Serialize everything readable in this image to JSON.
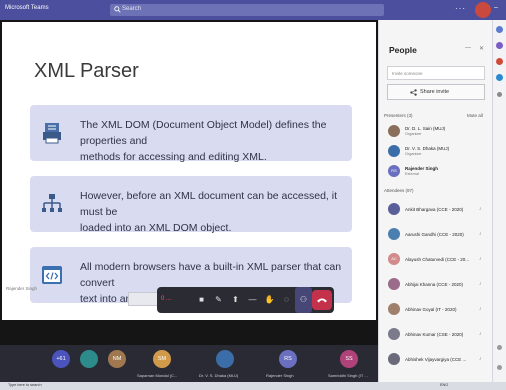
{
  "titlebar": {
    "app_title": "Microsoft Teams",
    "search_placeholder": "Search"
  },
  "slide": {
    "title": "XML Parser",
    "cards": [
      {
        "icon": "document-icon",
        "text_line1": "The XML DOM (Document Object Model) defines the properties and",
        "text_line2": "methods for accessing and editing XML."
      },
      {
        "icon": "hierarchy-icon",
        "text_line1": "However, before an XML document can be accessed, it must be",
        "text_line2": "loaded into an XML DOM object."
      },
      {
        "icon": "code-icon",
        "text_line1": "All modern browsers have a built-in XML parser that can convert",
        "text_line2": "text into an XML DOM object."
      }
    ],
    "presenter_label": "Rajender Singh"
  },
  "controls": {
    "timer": "0 ..."
  },
  "participants": [
    {
      "initials": "+61",
      "color": "#4b53bc",
      "name": ""
    },
    {
      "initials": "",
      "color": "#2e8b8b",
      "name": ""
    },
    {
      "initials": "NM",
      "color": "#a07850",
      "name": ""
    },
    {
      "initials": "SM",
      "color": "#d19a4a",
      "name": "Saparnan Mondal (C..."
    },
    {
      "initials": "",
      "color": "#3b6ea8",
      "name": "Dr. V. S. Dhaka (MUJ)"
    },
    {
      "initials": "RS",
      "color": "#6b6fbf",
      "name": "Rajender Singh"
    },
    {
      "initials": "SS",
      "color": "#b0427a",
      "name": "Samriddhi Singh (IT ..."
    }
  ],
  "people_panel": {
    "title": "People",
    "invite_placeholder": "Invite someone",
    "share_invite_label": "Share invite",
    "presenters_label": "Presenters (3)",
    "mute_all_label": "Mute all",
    "presenters": [
      {
        "initials": "",
        "color": "#8a6d5a",
        "name": "Dr. D. L. Sain (MUJ)",
        "role": "Organizer"
      },
      {
        "initials": "",
        "color": "#3b6ea8",
        "name": "Dr. V. S. Dhaka (MUJ)",
        "role": "Organizer"
      },
      {
        "initials": "RS",
        "color": "#6b6fbf",
        "name": "Rajender Singh",
        "role": "External"
      }
    ],
    "attendees_label": "Attendees (97)",
    "attendees": [
      {
        "initials": "",
        "color": "#5a5f9a",
        "name": "Ankit Bhargava (CCE - 2020)"
      },
      {
        "initials": "",
        "color": "#4a7fb0",
        "name": "Aarushi Gandhi (CCE - 2020)"
      },
      {
        "initials": "AC",
        "color": "#d28a8a",
        "name": "Alayush Chaturvedi (CCE - 20..."
      },
      {
        "initials": "",
        "color": "#9a6b8a",
        "name": "Abhijai Khanna (CCE - 2020)"
      },
      {
        "initials": "",
        "color": "#a0806a",
        "name": "Abhinav Goyal (IT - 2020)"
      },
      {
        "initials": "",
        "color": "#7a7a8a",
        "name": "Abhinav Kumar (CSE - 2020)"
      },
      {
        "initials": "",
        "color": "#6a6a7a",
        "name": "Abhishek Vijayvargiya (CCE ..."
      }
    ]
  },
  "taskbar": {
    "left_text": "Type here to search",
    "right_text": "ENG"
  }
}
